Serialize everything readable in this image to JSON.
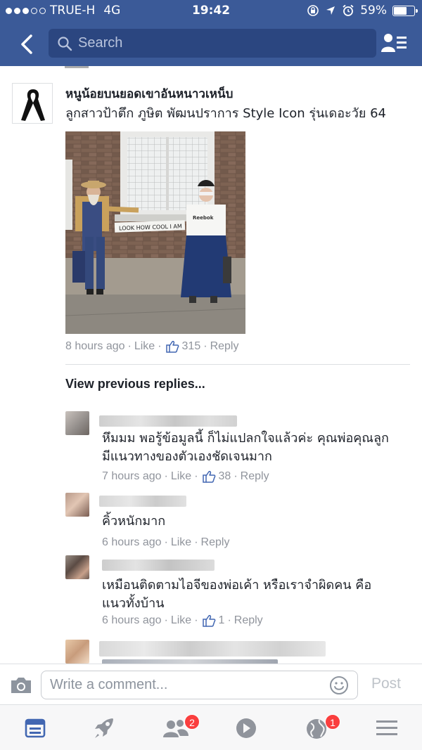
{
  "status_bar": {
    "carrier": "TRUE-H",
    "network": "4G",
    "time": "19:42",
    "battery": "59%",
    "battery_level": 0.59
  },
  "nav": {
    "search_placeholder": "Search"
  },
  "main_comment": {
    "author": "หนูน้อยบนยอดเขาอันหนาวเหน็บ",
    "text": "ลูกสาวป้าตึก ภูษิต พัฒนปราการ Style Icon รุ่นเดอะวัย 64",
    "photo_caption": "LOOK HOW COOL I AM",
    "shirt_brand": "Reebok",
    "time": "8 hours ago",
    "like_label": "Like",
    "like_count": "315",
    "reply_label": "Reply"
  },
  "view_previous_label": "View previous replies...",
  "replies": [
    {
      "lines": [
        "หึมมม พอรู้ข้อมูลนี้ ก็ไม่แปลกใจแล้วค่ะ คุณพ่อคุณลูก",
        "มีแนวทางของตัวเองชัดเจนมาก"
      ],
      "time": "7 hours ago",
      "like_label": "Like",
      "like_count": "38",
      "reply_label": "Reply"
    },
    {
      "lines": [
        "คิ้วหนักมาก"
      ],
      "time": "6 hours ago",
      "like_label": "Like",
      "reply_label": "Reply"
    },
    {
      "lines": [
        "เหมือนติดตามไอจีของพ่อเค้า หรือเราจำผิดคน คือ",
        "แนวทั้งบ้าน"
      ],
      "time": "6 hours ago",
      "like_label": "Like",
      "like_count": "1",
      "reply_label": "Reply"
    }
  ],
  "composer": {
    "placeholder": "Write a comment...",
    "post_label": "Post"
  },
  "tabbar": {
    "friend_requests_badge": "2",
    "notifications_badge": "1"
  },
  "colors": {
    "brand": "#3b5a98",
    "like_blue": "#4267b2",
    "badge_red": "#fa3e3e"
  }
}
